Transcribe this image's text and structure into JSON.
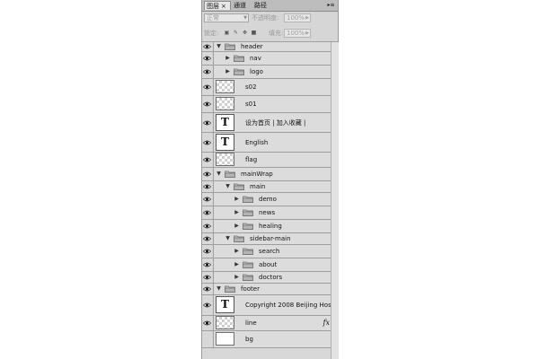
{
  "tabs": [
    {
      "label": "图层",
      "active": true,
      "close": "×"
    },
    {
      "label": "通道",
      "active": false
    },
    {
      "label": "路径",
      "active": false
    }
  ],
  "options": {
    "blend_mode": "正常",
    "opacity_label": "不透明度:",
    "opacity_value": "100%",
    "lock_label": "锁定:",
    "fill_label": "填充:",
    "fill_value": "100%"
  },
  "layers": [
    {
      "name": "header",
      "type": "group",
      "level": 0,
      "expanded": true
    },
    {
      "name": "nav",
      "type": "group",
      "level": 1,
      "expanded": false
    },
    {
      "name": "logo",
      "type": "group",
      "level": 1,
      "expanded": false
    },
    {
      "name": "s02",
      "type": "image",
      "level": 1
    },
    {
      "name": "s01",
      "type": "image",
      "level": 1
    },
    {
      "name": "设为首页 |    加入收藏 |",
      "type": "text",
      "level": 1
    },
    {
      "name": "English",
      "type": "text",
      "level": 1
    },
    {
      "name": "flag",
      "type": "image",
      "level": 1
    },
    {
      "name": "mainWrap",
      "type": "group",
      "level": 0,
      "expanded": true
    },
    {
      "name": "main",
      "type": "group",
      "level": 1,
      "expanded": true
    },
    {
      "name": "demo",
      "type": "group",
      "level": 2,
      "expanded": false
    },
    {
      "name": "news",
      "type": "group",
      "level": 2,
      "expanded": false
    },
    {
      "name": "healing",
      "type": "group",
      "level": 2,
      "expanded": false
    },
    {
      "name": "sidebar-main",
      "type": "group",
      "level": 1,
      "expanded": true
    },
    {
      "name": "search",
      "type": "group",
      "level": 2,
      "expanded": false
    },
    {
      "name": "about",
      "type": "group",
      "level": 2,
      "expanded": false
    },
    {
      "name": "doctors",
      "type": "group",
      "level": 2,
      "expanded": false
    },
    {
      "name": "footer",
      "type": "group",
      "level": 0,
      "expanded": true
    },
    {
      "name": "Copyright 2008 Beijing Hos...",
      "type": "text",
      "level": 1
    },
    {
      "name": "line",
      "type": "image",
      "level": 1,
      "fx": "fx"
    },
    {
      "name": "bg",
      "type": "image-white",
      "level": 0,
      "visible": false
    }
  ]
}
